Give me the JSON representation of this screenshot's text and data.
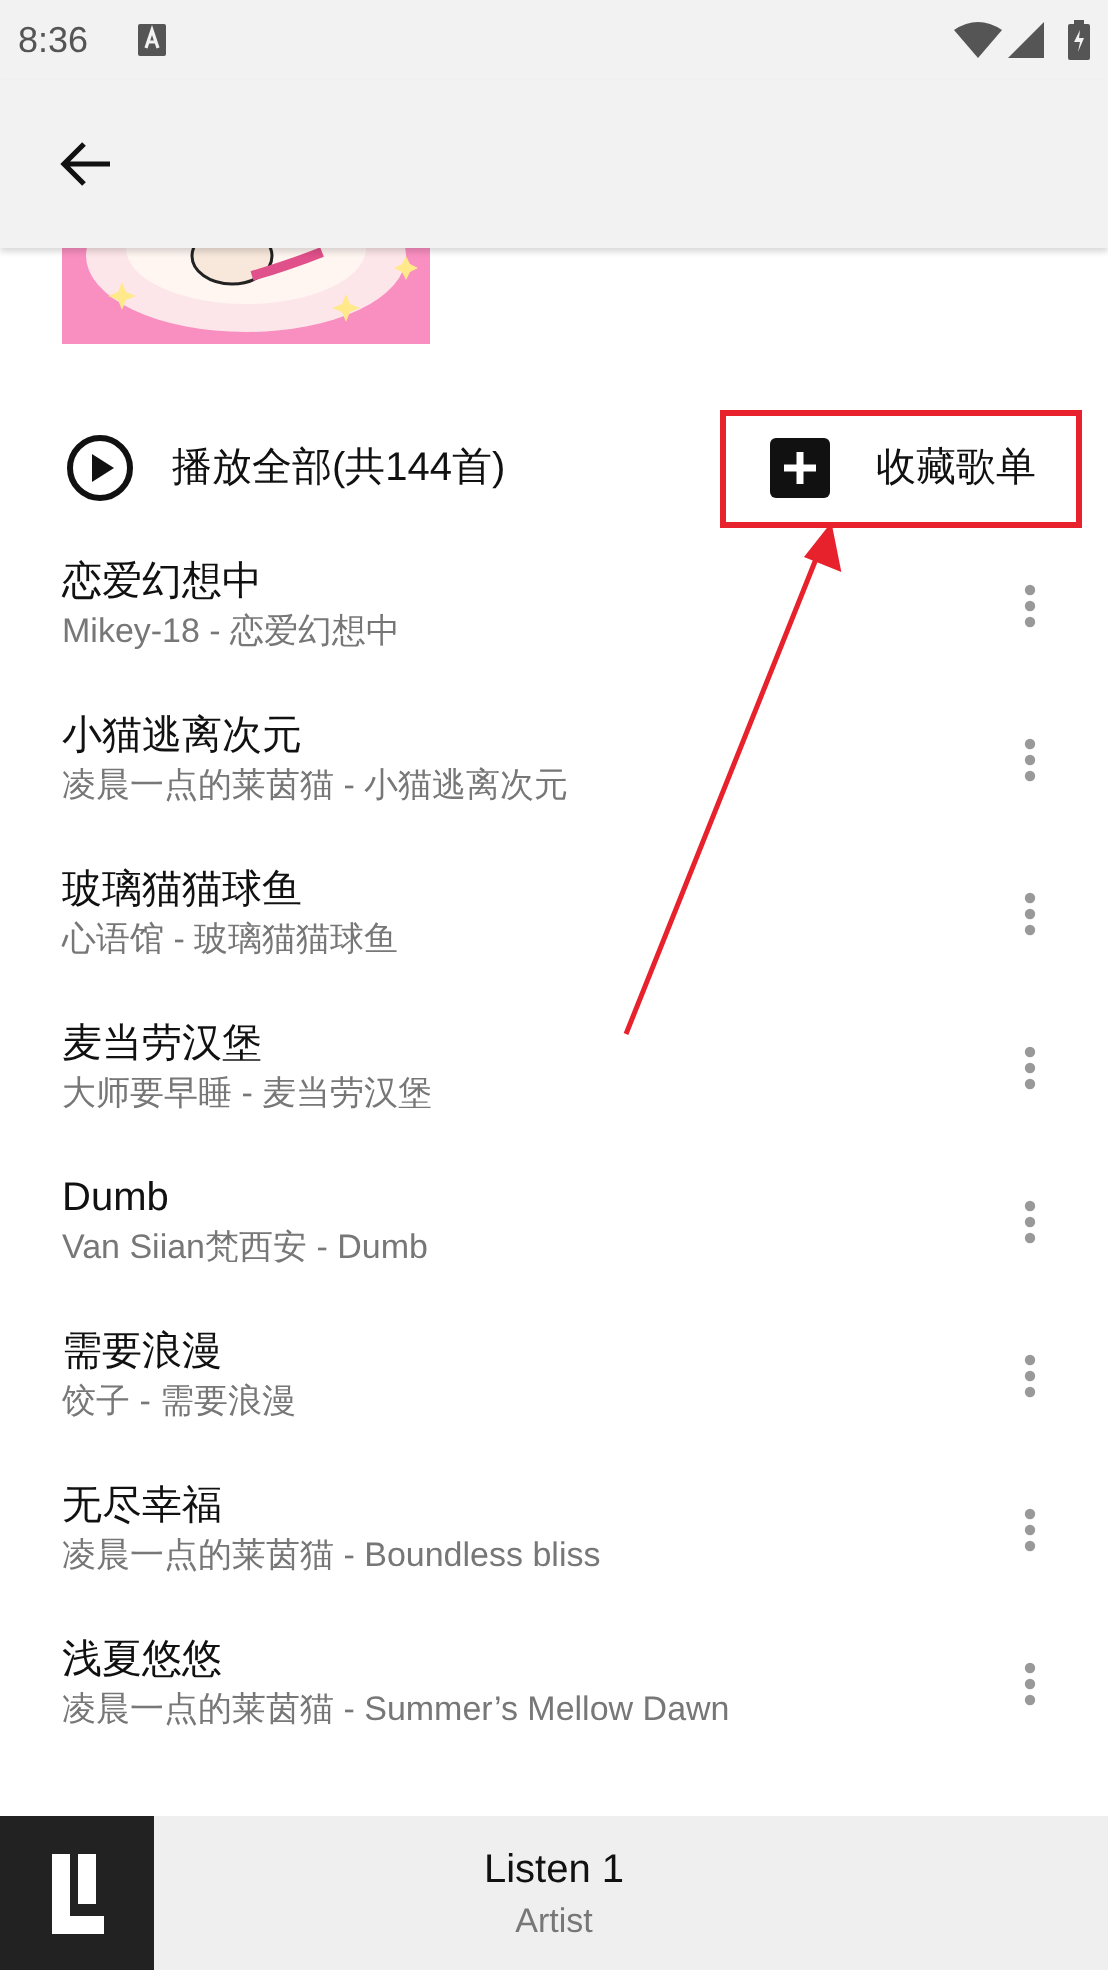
{
  "status_bar": {
    "time": "8:36"
  },
  "play_all": {
    "label": "播放全部(共144首)"
  },
  "collect_button": {
    "label": "收藏歌单",
    "highlighted": true
  },
  "songs": [
    {
      "title": "恋爱幻想中",
      "subtitle": "Mikey-18 - 恋爱幻想中"
    },
    {
      "title": "小猫逃离次元",
      "subtitle": "凌晨一点的莱茵猫 - 小猫逃离次元"
    },
    {
      "title": "玻璃猫猫球鱼",
      "subtitle": "心语馆 - 玻璃猫猫球鱼"
    },
    {
      "title": "麦当劳汉堡",
      "subtitle": "大师要早睡 - 麦当劳汉堡"
    },
    {
      "title": "Dumb",
      "subtitle": "Van Siian梵西安 - Dumb"
    },
    {
      "title": "需要浪漫",
      "subtitle": "饺子 - 需要浪漫"
    },
    {
      "title": "无尽幸福",
      "subtitle": "凌晨一点的莱茵猫 - Boundless bliss"
    },
    {
      "title": "浅夏悠悠",
      "subtitle": "凌晨一点的莱茵猫 - Summer’s Mellow Dawn"
    }
  ],
  "player": {
    "title": "Listen 1",
    "artist": "Artist"
  }
}
